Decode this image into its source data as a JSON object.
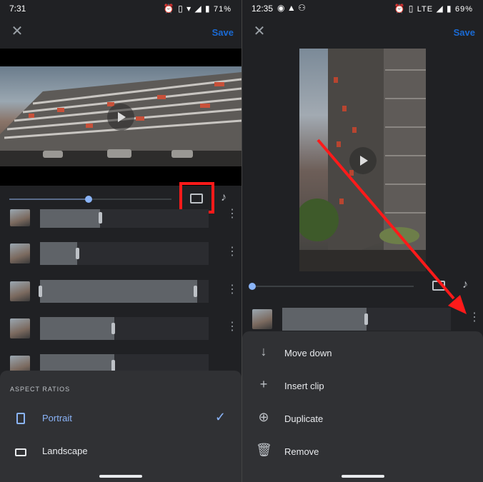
{
  "left": {
    "status": {
      "time": "7:31",
      "battery": "71%"
    },
    "save_label": "Save",
    "sheet": {
      "title": "ASPECT RATIOS",
      "options": [
        {
          "label": "Portrait",
          "selected": true,
          "icon": "portrait-icon"
        },
        {
          "label": "Landscape",
          "selected": false,
          "icon": "landscape-icon"
        }
      ]
    }
  },
  "right": {
    "status": {
      "time": "12:35",
      "network": "LTE",
      "battery": "69%"
    },
    "save_label": "Save",
    "menu": [
      {
        "label": "Move down",
        "icon": "arrow-down-icon"
      },
      {
        "label": "Insert clip",
        "icon": "plus-icon"
      },
      {
        "label": "Duplicate",
        "icon": "duplicate-icon"
      },
      {
        "label": "Remove",
        "icon": "trash-icon"
      }
    ]
  },
  "colors": {
    "accent": "#8ab4f8",
    "highlight": "#ff1a1a",
    "save": "#1a73e8"
  }
}
